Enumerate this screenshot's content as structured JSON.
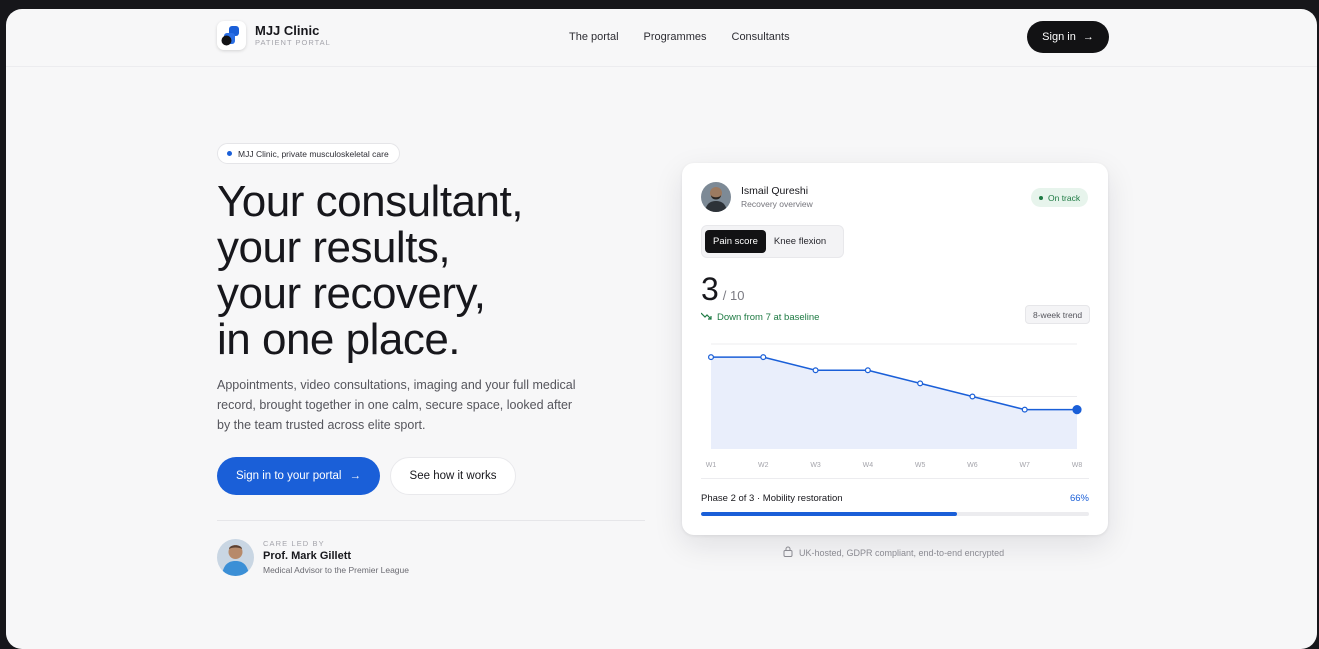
{
  "nav": {
    "brand_name": "MJJ Clinic",
    "brand_sub": "PATIENT PORTAL",
    "links": [
      "The portal",
      "Programmes",
      "Consultants"
    ],
    "signin_label": "Sign in",
    "signin_icon": "arrow-right-icon"
  },
  "hero": {
    "pill": "MJJ Clinic, private musculoskeletal care",
    "headline": [
      "Your consultant,",
      "your results,",
      "your recovery,",
      "in one place."
    ],
    "lead": "Appointments, video consultations, imaging and your full medical record, brought together in one calm, secure space, looked after by the team trusted across elite sport.",
    "primary_cta": "Sign in to your portal",
    "secondary_cta": "See how it works",
    "led_caption": "CARE LED BY",
    "led_name": "Prof. Mark Gillett",
    "led_role": "Medical Advisor to the Premier League"
  },
  "card": {
    "patient_name": "Ismail Qureshi",
    "patient_sub": "Recovery overview",
    "status": "On track",
    "tabs": [
      "Pain score",
      "Knee flexion"
    ],
    "active_tab": "Pain score",
    "score_value": "3",
    "score_max": "/ 10",
    "change": "Down from 7 at baseline",
    "trend_label": "8-week trend",
    "phase_label": "Phase 2 of 3 · Mobility restoration",
    "phase_pct": "66%",
    "phase_progress": 0.66
  },
  "chart_data": {
    "type": "area",
    "categories": [
      "W1",
      "W2",
      "W3",
      "W4",
      "W5",
      "W6",
      "W7",
      "W8"
    ],
    "values": [
      7,
      7,
      6,
      6,
      5,
      4,
      3,
      3
    ],
    "ylim": [
      0,
      8
    ],
    "grid": true,
    "line_color": "#1a5fd8",
    "fill_color": "#e9eefb"
  },
  "footer_note": "UK-hosted, GDPR compliant, end-to-end encrypted",
  "colors": {
    "accent": "#1a5fd8",
    "dark": "#121214",
    "success": "#1e7a43"
  }
}
